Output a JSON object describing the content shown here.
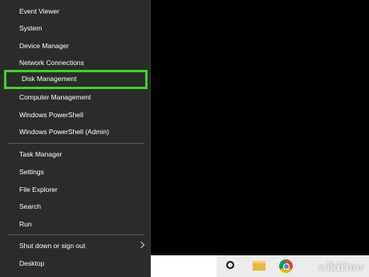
{
  "menu": {
    "items": [
      {
        "label": "Event Viewer"
      },
      {
        "label": "System"
      },
      {
        "label": "Device Manager"
      },
      {
        "label": "Network Connections"
      },
      {
        "label": "Disk Management"
      },
      {
        "label": "Computer Management"
      },
      {
        "label": "Windows PowerShell"
      },
      {
        "label": "Windows PowerShell (Admin)"
      },
      {
        "label": "Task Manager"
      },
      {
        "label": "Settings"
      },
      {
        "label": "File Explorer"
      },
      {
        "label": "Search"
      },
      {
        "label": "Run"
      },
      {
        "label": "Shut down or sign out"
      },
      {
        "label": "Desktop"
      }
    ],
    "highlight_color": "#3fd12a",
    "background_color": "#2b2b2b"
  },
  "taskbar": {
    "icons": [
      "cortana-icon",
      "file-explorer-icon",
      "chrome-icon"
    ]
  },
  "watermark": "wikiHow"
}
